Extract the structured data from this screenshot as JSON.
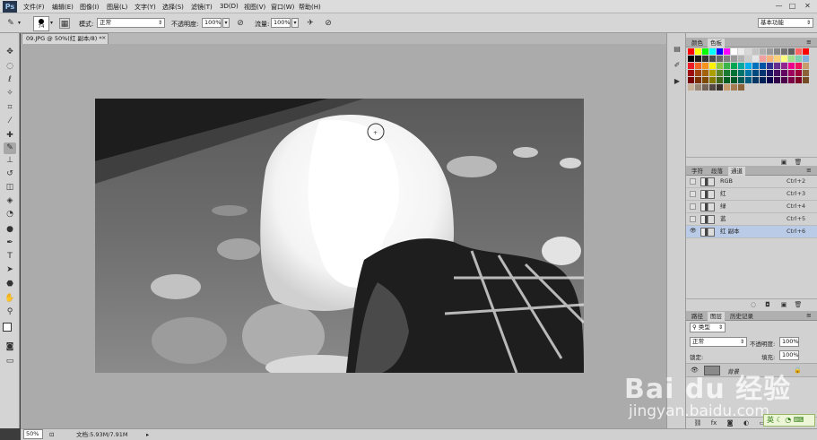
{
  "app": {
    "logo": "Ps"
  },
  "menu": [
    "文件(F)",
    "编辑(E)",
    "图像(I)",
    "图层(L)",
    "文字(Y)",
    "选择(S)",
    "滤镜(T)",
    "3D(D)",
    "视图(V)",
    "窗口(W)",
    "帮助(H)"
  ],
  "window_controls": {
    "minimize": "—",
    "restore": "□",
    "close": "✕"
  },
  "options": {
    "brush_size": "74",
    "mode_label": "模式:",
    "mode_value": "正常",
    "opacity_label": "不透明度:",
    "opacity_value": "100%",
    "flow_label": "流量:",
    "flow_value": "100%",
    "workspace": "基本功能"
  },
  "document": {
    "tab_title": "09.JPG @ 50%(红 副本/8) *",
    "zoom": "50%",
    "doc_info": "文档:5.93M/7.91M"
  },
  "color_panel": {
    "tabs": [
      "颜色",
      "色板"
    ],
    "active_tab": "色板",
    "swatch_colors": [
      "#ff0000",
      "#ffff00",
      "#00ff00",
      "#00ffff",
      "#0000ff",
      "#ff00ff",
      "#ffffff",
      "#ebebeb",
      "#d7d7d7",
      "#c3c3c3",
      "#afafaf",
      "#9b9b9b",
      "#878787",
      "#737373",
      "#5f5f5f",
      "#ff6464",
      "#ff0000",
      "#000000",
      "#191919",
      "#333333",
      "#4c4c4c",
      "#666666",
      "#7f7f7f",
      "#999999",
      "#b2b2b2",
      "#cccccc",
      "#e5e5e5",
      "#f0a0a0",
      "#f7b27a",
      "#fbd27a",
      "#ffff80",
      "#a0e08a",
      "#7fd0b0",
      "#80b0e0",
      "#ed1c24",
      "#f26522",
      "#f7941d",
      "#fff200",
      "#8dc63f",
      "#39b54a",
      "#00a651",
      "#00a99d",
      "#00aeef",
      "#0072bc",
      "#0054a6",
      "#2e3192",
      "#662d91",
      "#92278f",
      "#ec008c",
      "#ed145b",
      "#c69c6d",
      "#9e0b0f",
      "#a0410d",
      "#a3620a",
      "#aba000",
      "#598527",
      "#197b30",
      "#007236",
      "#00746b",
      "#0076a3",
      "#004a80",
      "#003471",
      "#1b1464",
      "#440e62",
      "#630460",
      "#9e005d",
      "#9e0039",
      "#8c6239",
      "#790000",
      "#7b2e00",
      "#7d4900",
      "#827b00",
      "#406618",
      "#005e20",
      "#005826",
      "#005952",
      "#005b7f",
      "#003663",
      "#002157",
      "#0d004c",
      "#32004b",
      "#4b0049",
      "#7b0046",
      "#7a0026",
      "#754c24",
      "#c7b299",
      "#998675",
      "#736357",
      "#534741",
      "#37302a",
      "#c69c6d",
      "#a67c52",
      "#8c6239"
    ]
  },
  "channels_panel": {
    "tabs": [
      "字符",
      "段落",
      "通道"
    ],
    "active_tab": "通道",
    "rows": [
      {
        "name": "RGB",
        "shortcut": "Ctrl+2",
        "visible": false,
        "selected": false
      },
      {
        "name": "红",
        "shortcut": "Ctrl+3",
        "visible": false,
        "selected": false
      },
      {
        "name": "绿",
        "shortcut": "Ctrl+4",
        "visible": false,
        "selected": false
      },
      {
        "name": "蓝",
        "shortcut": "Ctrl+5",
        "visible": false,
        "selected": false
      },
      {
        "name": "红 副本",
        "shortcut": "Ctrl+6",
        "visible": true,
        "selected": true
      }
    ]
  },
  "layers_panel": {
    "tabs": [
      "路径",
      "图层",
      "历史记录"
    ],
    "active_tab": "图层",
    "kind_label": "类型",
    "blend_mode": "正常",
    "opacity_label": "不透明度:",
    "opacity_value": "100%",
    "lock_label": "锁定:",
    "fill_label": "填充:",
    "fill_value": "100%",
    "layer_name": "背景"
  },
  "watermark": {
    "brand": "Bai du 经验",
    "url": "jingyan.baidu.com"
  },
  "ime": {
    "label": "英"
  }
}
